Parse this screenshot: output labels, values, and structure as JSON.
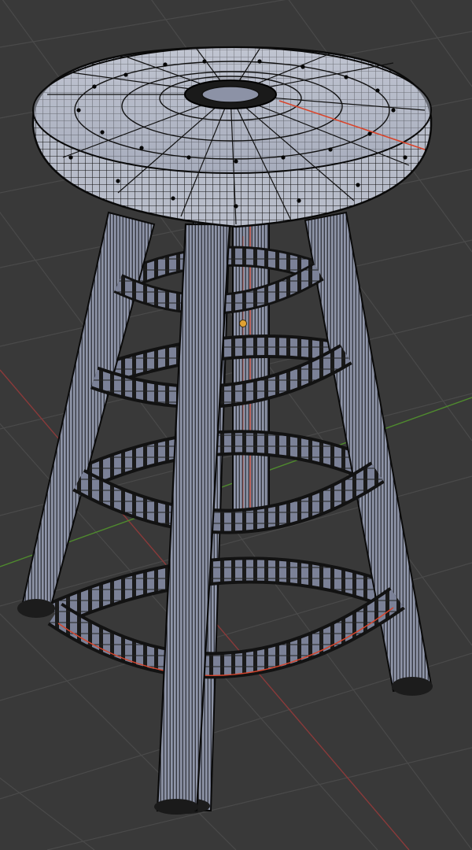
{
  "viewport": {
    "background_color": "#393939",
    "grid_line_color": "#4a4a4a",
    "x_axis_color": "#8a3a3a",
    "y_axis_color": "#4f8a2e"
  },
  "model": {
    "wire_color": "#111111",
    "surface_color": "#b7bcc9",
    "surface_shadow_color": "#6c7388",
    "selected_edge_color": "#d8452c",
    "origin_dot_color": "#e1a233",
    "vertex_dot_color": "#050505"
  }
}
